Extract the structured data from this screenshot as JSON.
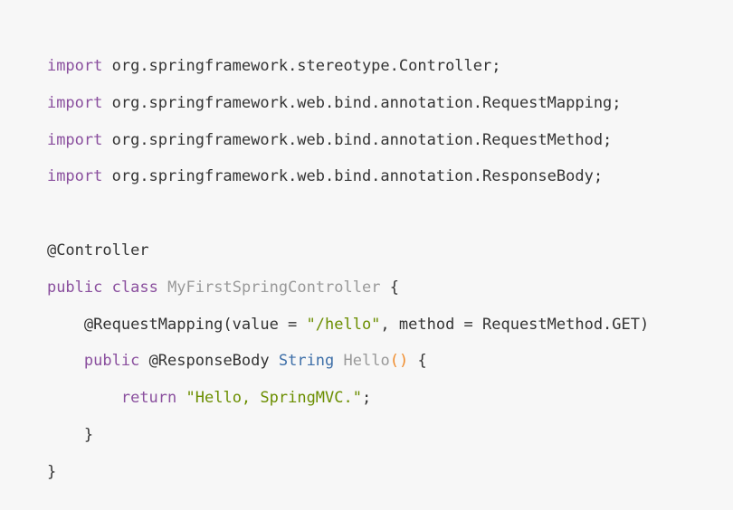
{
  "code": {
    "lines": [
      [
        {
          "t": "keyword",
          "v": "import"
        },
        {
          "t": "plain",
          "v": " org.springframework.stereotype.Controller;"
        }
      ],
      [
        {
          "t": "keyword",
          "v": "import"
        },
        {
          "t": "plain",
          "v": " org.springframework.web.bind.annotation.RequestMapping;"
        }
      ],
      [
        {
          "t": "keyword",
          "v": "import"
        },
        {
          "t": "plain",
          "v": " org.springframework.web.bind.annotation.RequestMethod;"
        }
      ],
      [
        {
          "t": "keyword",
          "v": "import"
        },
        {
          "t": "plain",
          "v": " org.springframework.web.bind.annotation.ResponseBody;"
        }
      ],
      [],
      [
        {
          "t": "annotation",
          "v": "@Controller"
        }
      ],
      [
        {
          "t": "keyword",
          "v": "public"
        },
        {
          "t": "plain",
          "v": " "
        },
        {
          "t": "keyword",
          "v": "class"
        },
        {
          "t": "plain",
          "v": " "
        },
        {
          "t": "classname",
          "v": "MyFirstSpringController"
        },
        {
          "t": "plain",
          "v": " {"
        }
      ],
      [
        {
          "t": "plain",
          "v": "    @RequestMapping(value = "
        },
        {
          "t": "string",
          "v": "\"/hello\""
        },
        {
          "t": "plain",
          "v": ", method = RequestMethod.GET)"
        }
      ],
      [
        {
          "t": "plain",
          "v": "    "
        },
        {
          "t": "keyword",
          "v": "public"
        },
        {
          "t": "plain",
          "v": " @ResponseBody "
        },
        {
          "t": "type",
          "v": "String"
        },
        {
          "t": "plain",
          "v": " "
        },
        {
          "t": "classname",
          "v": "Hello"
        },
        {
          "t": "paren",
          "v": "()"
        },
        {
          "t": "plain",
          "v": " {"
        }
      ],
      [
        {
          "t": "plain",
          "v": "        "
        },
        {
          "t": "return",
          "v": "return"
        },
        {
          "t": "plain",
          "v": " "
        },
        {
          "t": "string",
          "v": "\"Hello, SpringMVC.\""
        },
        {
          "t": "plain",
          "v": ";"
        }
      ],
      [
        {
          "t": "plain",
          "v": "    }"
        }
      ],
      [
        {
          "t": "plain",
          "v": "}"
        }
      ]
    ]
  },
  "colors": {
    "background": "#f7f7f7",
    "keyword": "#8a4f9e",
    "string": "#6b8e00",
    "type": "#3e6fa8",
    "classname": "#999999",
    "paren": "#f08c2c"
  }
}
